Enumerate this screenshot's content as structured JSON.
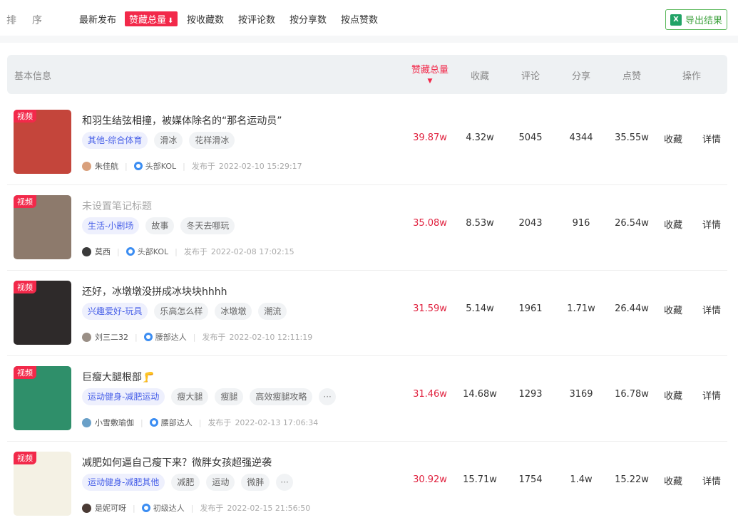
{
  "sort": {
    "label": "排序",
    "options": [
      "最新发布",
      "赞藏总量",
      "按收藏数",
      "按评论数",
      "按分享数",
      "按点赞数"
    ],
    "active_arrow": "⬇",
    "export_label": "导出结果"
  },
  "table": {
    "headers": {
      "basic": "基本信息",
      "total": "赞藏总量",
      "collect": "收藏",
      "comment": "评论",
      "share": "分享",
      "like": "点赞",
      "action": "操作"
    },
    "badge": "视频",
    "published_prefix": "发布于",
    "action_collect": "收藏",
    "action_detail": "详情",
    "more_glyph": "···",
    "rows": [
      {
        "title": "和羽生结弦相撞，被媒体除名的“那名运动员”",
        "tags": [
          "其他-综合体育",
          "滑冰",
          "花样滑冰"
        ],
        "author": "朱佳航",
        "level": "头部KOL",
        "date": "2022-02-10 15:29:17",
        "total": "39.87w",
        "collect": "4.32w",
        "comment": "5045",
        "share": "4344",
        "like": "35.55w",
        "thumb_color": "#c4453b"
      },
      {
        "title": "未设置笔记标题",
        "tags": [
          "生活-小剧场",
          "故事",
          "冬天去哪玩"
        ],
        "author": "莫西",
        "level": "头部KOL",
        "date": "2022-02-08 17:02:15",
        "total": "35.08w",
        "collect": "8.53w",
        "comment": "2043",
        "share": "916",
        "like": "26.54w",
        "thumb_color": "#8d7a6c"
      },
      {
        "title": "还好，冰墩墩没拼成冰块块hhhh",
        "tags": [
          "兴趣爱好-玩具",
          "乐高怎么样",
          "冰墩墩",
          "潮流"
        ],
        "author": "刘三二32",
        "level": "腰部达人",
        "date": "2022-02-10 12:11:19",
        "total": "31.59w",
        "collect": "5.14w",
        "comment": "1961",
        "share": "1.71w",
        "like": "26.44w",
        "thumb_color": "#2e2a2a"
      },
      {
        "title": "巨瘦大腿根部",
        "title_emoji": "🦵",
        "tags": [
          "运动健身-减肥运动",
          "瘦大腿",
          "瘦腿",
          "高效瘦腿攻略"
        ],
        "has_more": true,
        "author": "小雪敷瑜伽",
        "level": "腰部达人",
        "date": "2022-02-13 17:06:34",
        "total": "31.46w",
        "collect": "14.68w",
        "comment": "1293",
        "share": "3169",
        "like": "16.78w",
        "thumb_color": "#2f8f6a"
      },
      {
        "title": "减肥如何逼自己瘦下来？微胖女孩超强逆袭",
        "tags": [
          "运动健身-减肥其他",
          "减肥",
          "运动",
          "微胖"
        ],
        "has_more": true,
        "author": "是妮可呀",
        "level": "初级达人",
        "date": "2022-02-15 21:56:50",
        "total": "30.92w",
        "collect": "15.71w",
        "comment": "1754",
        "share": "1.4w",
        "like": "15.22w",
        "thumb_color": "#f4f1e4"
      }
    ]
  },
  "colors": {
    "accent": "#f2294a",
    "category_tag": "#4961e8",
    "export_green": "#3ca13c"
  }
}
